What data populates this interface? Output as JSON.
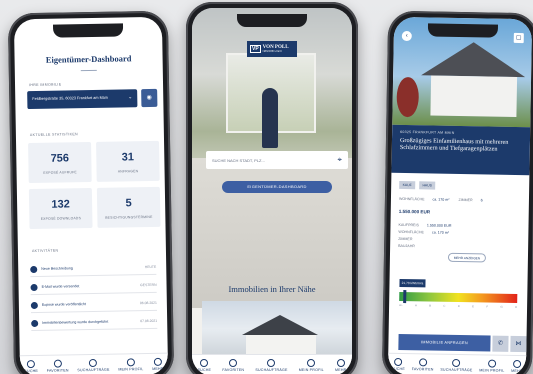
{
  "phone1": {
    "title": "Eigentümer-Dashboard",
    "section_property": "IHRE IMMOBILIE",
    "property_select": "Feldbergstraße 35, 60323 Frankfurt am Main",
    "section_stats": "AKTUELLE STATISTIKEN",
    "stats": [
      {
        "value": "756",
        "caption": "EXPOSÉ AUFRUFE"
      },
      {
        "value": "31",
        "caption": "ANFRAGEN"
      },
      {
        "value": "132",
        "caption": "EXPOSÉ DOWNLOADS"
      },
      {
        "value": "5",
        "caption": "BESICHTIGUNGSTERMINE"
      }
    ],
    "section_activities": "AKTIVITÄTEN",
    "activities": [
      {
        "text": "Neue Beschreibung",
        "date": "HEUTE"
      },
      {
        "text": "E-Mail wurde versendet",
        "date": "GESTERN"
      },
      {
        "text": "Exposé wurde veröffentlicht",
        "date": "06.08.2021"
      },
      {
        "text": "Immobilienbewertung wurde durchgeführt",
        "date": "07.08.2021"
      }
    ],
    "tabs": [
      "SUCHE",
      "FAVORITEN",
      "SUCHAUFTRÄGE",
      "MEIN PROFIL",
      "MEHR"
    ]
  },
  "phone2": {
    "logo_mark": "VP",
    "logo_name": "VON POLL",
    "logo_sub": "IMMOBILIEN",
    "search_placeholder": "SUCHE NACH STADT, PLZ...",
    "dashboard_button": "EIGENTÜMER-DASHBOARD",
    "nearby_heading": "Immobilien in Ihrer Nähe",
    "tabs": [
      "SUCHE",
      "FAVORITEN",
      "SUCHAUFTRÄGE",
      "MEIN PROFIL",
      "MEHR"
    ]
  },
  "phone3": {
    "location": "60325 FRANKFURT AM MAIN",
    "title": "Großzügiges Einfamilienhaus mit mehreren Schlafzimmern und Tiefgaragenplätzen",
    "chips": [
      "KAUF",
      "HAUS"
    ],
    "living_label": "WOHNFLÄCHE",
    "living_value": "ca. 170 m²",
    "rooms_label": "ZIMMER",
    "rooms_value": "6",
    "price": "1.550.000 EUR",
    "details": [
      {
        "label": "KAUFPREIS",
        "value": "1.550.000 EUR"
      },
      {
        "label": "WOHNFLÄCHE",
        "value": "ca. 170 m²"
      },
      {
        "label": "ZIMMER",
        "value": ""
      },
      {
        "label": "BAUJAHR",
        "value": ""
      }
    ],
    "more_button": "MEHR ANZEIGEN",
    "energy_value": "21,70 kWh/m²a",
    "energy_scale": [
      "A+",
      "A",
      "B",
      "C",
      "D",
      "E",
      "F",
      "G",
      "H"
    ],
    "cta_button": "IMMOBILIE ANFRAGEN",
    "tabs": [
      "SUCHE",
      "FAVORITEN",
      "SUCHAUFTRÄGE",
      "MEIN PROFIL",
      "MEHR"
    ]
  }
}
